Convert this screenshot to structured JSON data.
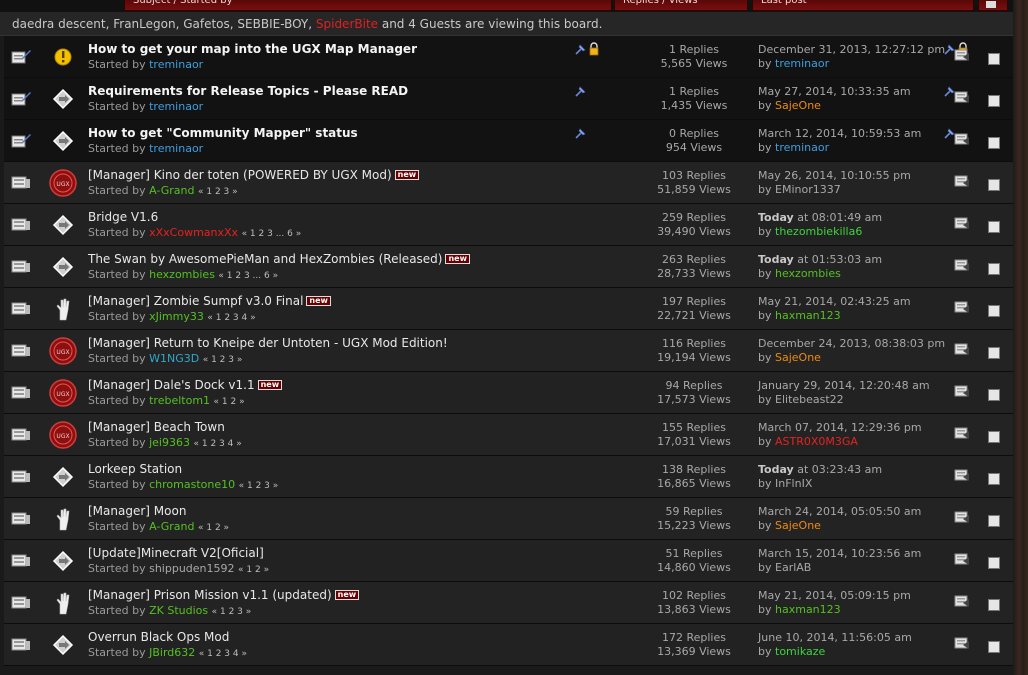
{
  "header": {
    "col_subject": "Subject / Started by",
    "col_stats": "Replies / Views",
    "col_last": "Last post"
  },
  "viewers": {
    "before": "daedra descent, FranLegon, Gafetos, SEBBIE-BOY, ",
    "red_user": "SpiderBite",
    "after": " and 4 Guests are viewing this board."
  },
  "colors": {
    "blue": "#3d9fe0",
    "green": "#55c022",
    "red": "#e82121",
    "orange": "#f08a12",
    "lime": "#3dd53d",
    "grey": "#a8a8a8",
    "teal": "#30a8c8"
  },
  "topics": [
    {
      "sticky": true,
      "icon": "warning",
      "title": "How to get your map into the UGX Map Manager",
      "new": false,
      "started_by": "treminaor",
      "sc": "blue",
      "pages": "",
      "pin": true,
      "lock": true,
      "replies": "1 Replies",
      "views": "5,565 Views",
      "last_bold": "",
      "last_date": "December 31, 2013, 12:27:12 pm",
      "last_by": "treminaor",
      "lc": "blue"
    },
    {
      "sticky": true,
      "icon": "diamond",
      "title": "Requirements for Release Topics - Please READ",
      "new": false,
      "started_by": "treminaor",
      "sc": "blue",
      "pages": "",
      "pin": true,
      "lock": false,
      "replies": "1 Replies",
      "views": "1,435 Views",
      "last_bold": "",
      "last_date": "May 27, 2014, 10:33:35 am",
      "last_by": "SajeOne",
      "lc": "orange"
    },
    {
      "sticky": true,
      "icon": "diamond",
      "title": "How to get \"Community Mapper\" status",
      "new": false,
      "started_by": "treminaor",
      "sc": "blue",
      "pages": "",
      "pin": true,
      "lock": false,
      "replies": "0 Replies",
      "views": "954 Views",
      "last_bold": "",
      "last_date": "March 12, 2014, 10:59:53 am",
      "last_by": "treminaor",
      "lc": "blue"
    },
    {
      "sticky": false,
      "icon": "seal",
      "title": "[Manager] Kino der toten (POWERED BY UGX Mod)",
      "new": true,
      "started_by": "A-Grand",
      "sc": "green",
      "pages": "« 1 2 3 »",
      "pin": false,
      "lock": false,
      "replies": "103 Replies",
      "views": "51,859 Views",
      "last_bold": "",
      "last_date": "May 26, 2014, 10:10:55 pm",
      "last_by": "EMinor1337",
      "lc": "grey"
    },
    {
      "sticky": false,
      "icon": "diamond",
      "title": "Bridge V1.6",
      "new": false,
      "started_by": "xXxCowmanxXx",
      "sc": "red",
      "pages": "« 1 2 3 ... 6 »",
      "pin": false,
      "lock": false,
      "replies": "259 Replies",
      "views": "39,490 Views",
      "last_bold": "Today",
      "last_date": " at 08:01:49 am",
      "last_by": "thezombiekilla6",
      "lc": "lime"
    },
    {
      "sticky": false,
      "icon": "diamond",
      "title": "The Swan by AwesomePieMan and HexZombies (Released)",
      "new": true,
      "started_by": "hexzombies",
      "sc": "green",
      "pages": "« 1 2 3 ... 6 »",
      "pin": false,
      "lock": false,
      "replies": "263 Replies",
      "views": "28,733 Views",
      "last_bold": "Today",
      "last_date": " at 01:53:03 am",
      "last_by": "hexzombies",
      "lc": "green"
    },
    {
      "sticky": false,
      "icon": "hand",
      "title": "[Manager] Zombie Sumpf v3.0 Final",
      "new": true,
      "started_by": "xJimmy33",
      "sc": "green",
      "pages": "« 1 2 3 4 »",
      "pin": false,
      "lock": false,
      "replies": "197 Replies",
      "views": "22,721 Views",
      "last_bold": "",
      "last_date": "May 21, 2014, 02:43:25 am",
      "last_by": "haxman123",
      "lc": "green"
    },
    {
      "sticky": false,
      "icon": "seal",
      "title": "[Manager] Return to Kneipe der Untoten - UGX Mod Edition!",
      "new": false,
      "started_by": "W1NG3D",
      "sc": "teal",
      "pages": "« 1 2 3 »",
      "pin": false,
      "lock": false,
      "replies": "116 Replies",
      "views": "19,194 Views",
      "last_bold": "",
      "last_date": "December 24, 2013, 08:38:03 pm",
      "last_by": "SajeOne",
      "lc": "orange"
    },
    {
      "sticky": false,
      "icon": "seal",
      "title": "[Manager] Dale's Dock v1.1",
      "new": true,
      "started_by": "trebeltom1",
      "sc": "green",
      "pages": "« 1 2 »",
      "pin": false,
      "lock": false,
      "replies": "94 Replies",
      "views": "17,573 Views",
      "last_bold": "",
      "last_date": "January 29, 2014, 12:20:48 am",
      "last_by": "Elitebeast22",
      "lc": "grey"
    },
    {
      "sticky": false,
      "icon": "seal",
      "title": "[Manager] Beach Town",
      "new": false,
      "started_by": "jei9363",
      "sc": "green",
      "pages": "« 1 2 3 4 »",
      "pin": false,
      "lock": false,
      "replies": "155 Replies",
      "views": "17,031 Views",
      "last_bold": "",
      "last_date": "March 07, 2014, 12:29:36 pm",
      "last_by": "ASTR0X0M3GA",
      "lc": "red"
    },
    {
      "sticky": false,
      "icon": "diamond",
      "title": "Lorkeep Station",
      "new": false,
      "started_by": "chromastone10",
      "sc": "green",
      "pages": "« 1 2 3 »",
      "pin": false,
      "lock": false,
      "replies": "138 Replies",
      "views": "16,865 Views",
      "last_bold": "Today",
      "last_date": " at 03:23:43 am",
      "last_by": "InFlnIX",
      "lc": "grey"
    },
    {
      "sticky": false,
      "icon": "hand",
      "title": "[Manager] Moon",
      "new": false,
      "started_by": "A-Grand",
      "sc": "green",
      "pages": "« 1 2 »",
      "pin": false,
      "lock": false,
      "replies": "59 Replies",
      "views": "15,223 Views",
      "last_bold": "",
      "last_date": "March 24, 2014, 05:05:50 am",
      "last_by": "SajeOne",
      "lc": "orange"
    },
    {
      "sticky": false,
      "icon": "diamond",
      "title": "[Update]Minecraft V2[Oficial]",
      "new": false,
      "started_by": "shippuden1592",
      "sc": "grey",
      "pages": "« 1 2 »",
      "pin": false,
      "lock": false,
      "replies": "51 Replies",
      "views": "14,860 Views",
      "last_bold": "",
      "last_date": "March 15, 2014, 10:23:56 am",
      "last_by": "EarlAB",
      "lc": "grey"
    },
    {
      "sticky": false,
      "icon": "hand",
      "title": "[Manager] Prison Mission v1.1 (updated)",
      "new": true,
      "started_by": "ZK Studios",
      "sc": "green",
      "pages": "« 1 2 3 »",
      "pin": false,
      "lock": false,
      "replies": "102 Replies",
      "views": "13,863 Views",
      "last_bold": "",
      "last_date": "May 21, 2014, 05:09:15 pm",
      "last_by": "haxman123",
      "lc": "green"
    },
    {
      "sticky": false,
      "icon": "diamond",
      "title": "Overrun Black Ops Mod",
      "new": false,
      "started_by": "JBird632",
      "sc": "green",
      "pages": "« 1 2 3 4 »",
      "pin": false,
      "lock": false,
      "replies": "172 Replies",
      "views": "13,369 Views",
      "last_bold": "",
      "last_date": "June 10, 2014, 11:56:05 am",
      "last_by": "tomikaze",
      "lc": "lime"
    }
  ],
  "labels": {
    "started_prefix": "Started by ",
    "by_prefix": "by ",
    "new_badge": "new"
  }
}
